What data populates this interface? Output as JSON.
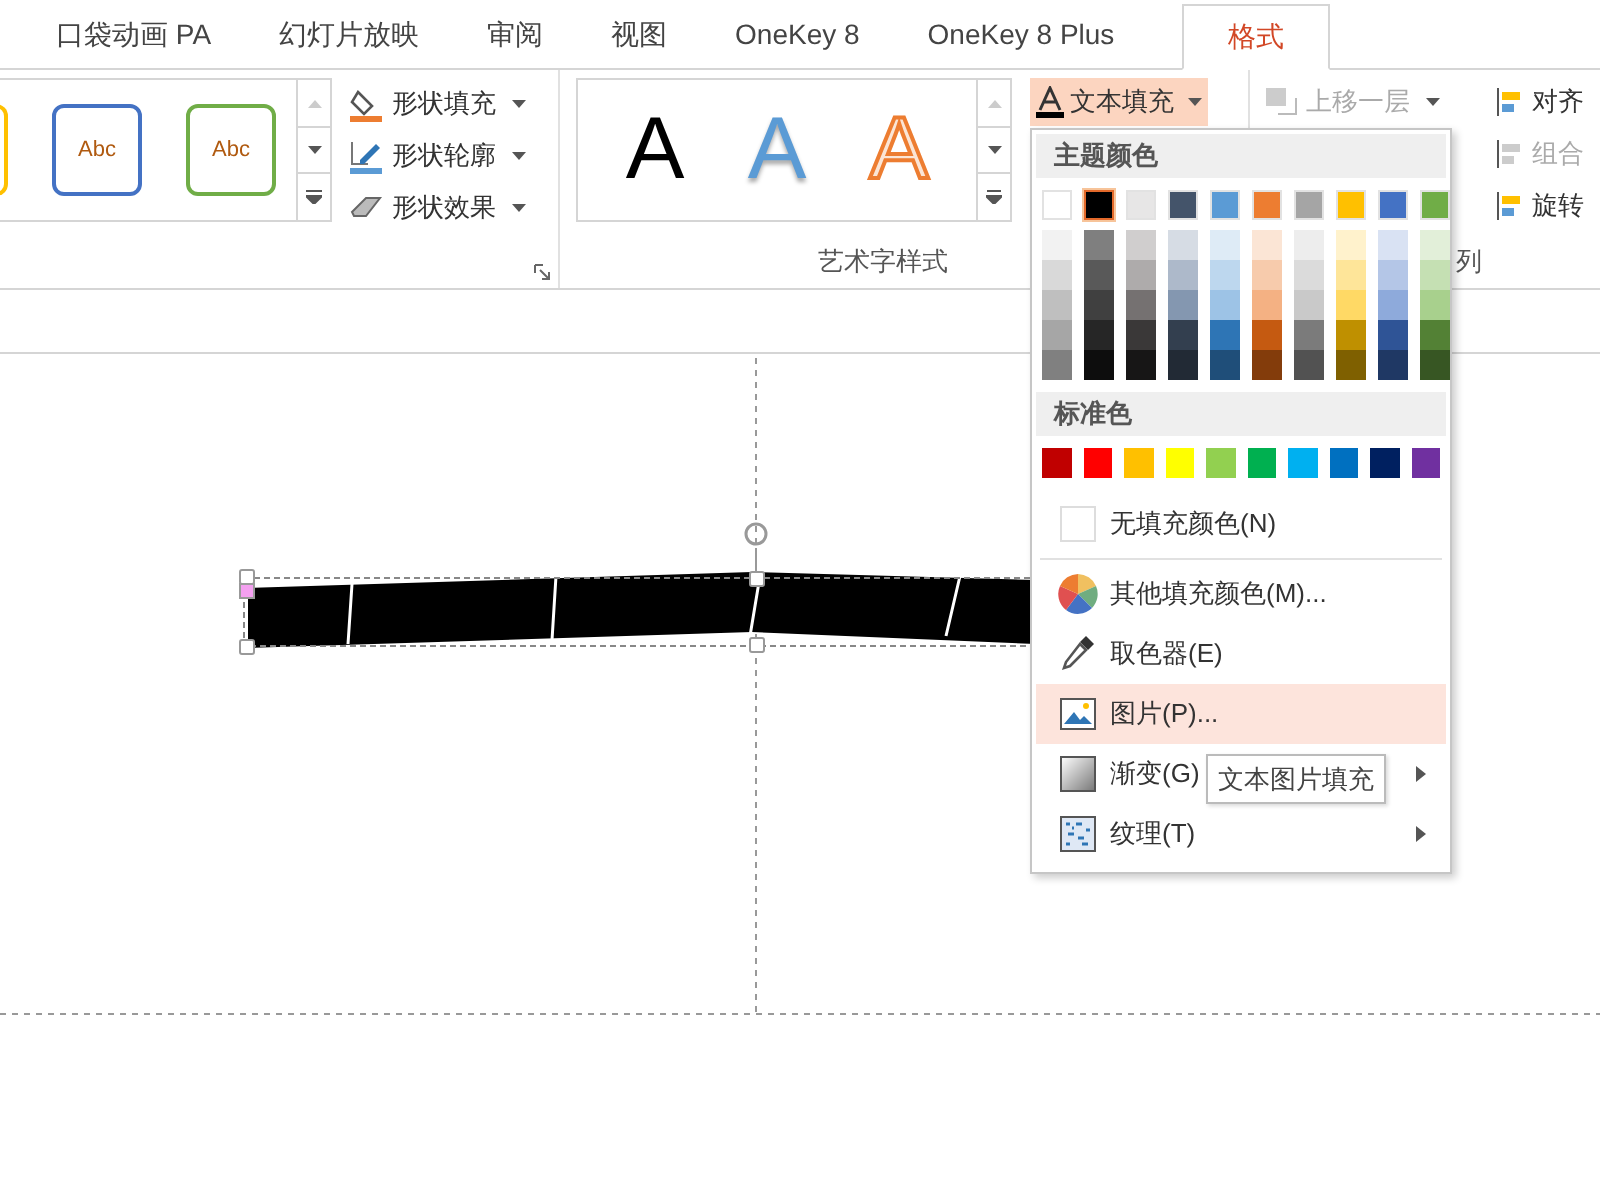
{
  "tabs": [
    {
      "label": "口袋动画 PA",
      "selected": false
    },
    {
      "label": "幻灯片放映",
      "selected": false
    },
    {
      "label": "审阅",
      "selected": false
    },
    {
      "label": "视图",
      "selected": false
    },
    {
      "label": "OneKey 8",
      "selected": false
    },
    {
      "label": "OneKey 8 Plus",
      "selected": false
    },
    {
      "label": "格式",
      "selected": true
    }
  ],
  "shape_styles": {
    "thumbnails": [
      {
        "color": "#ffc000"
      },
      {
        "label": "Abc",
        "color": "#4472c4"
      },
      {
        "label": "Abc",
        "color": "#70ad47"
      }
    ],
    "commands": [
      {
        "label": "形状填充",
        "kind": "fill"
      },
      {
        "label": "形状轮廓",
        "kind": "outline"
      },
      {
        "label": "形状效果",
        "kind": "effect"
      }
    ]
  },
  "wordart": {
    "label": "艺术字样式",
    "samples": [
      {
        "text": "A",
        "kind": "plain"
      },
      {
        "text": "A",
        "kind": "blue"
      },
      {
        "text": "A",
        "kind": "outline"
      }
    ],
    "text_fill": {
      "label": "文本填充",
      "expanded": true
    }
  },
  "arrange": {
    "commands": [
      {
        "label": "上移一层",
        "disabled": true
      },
      {
        "label": "对齐",
        "disabled": false
      },
      {
        "label": "组合",
        "disabled": true
      },
      {
        "label": "旋转",
        "disabled": false
      }
    ],
    "label": "列"
  },
  "menu": {
    "theme_header": "主题颜色",
    "theme_colors": [
      {
        "color": "#ffffff",
        "selected": false,
        "shades": [
          {
            "color": "#f2f2f2"
          },
          {
            "color": "#d9d9d9"
          },
          {
            "color": "#bfbfbf"
          },
          {
            "color": "#a6a6a6"
          },
          {
            "color": "#808080"
          }
        ]
      },
      {
        "color": "#000000",
        "selected": true,
        "shades": [
          {
            "color": "#7f7f7f"
          },
          {
            "color": "#595959"
          },
          {
            "color": "#404040"
          },
          {
            "color": "#262626"
          },
          {
            "color": "#0d0d0d"
          }
        ]
      },
      {
        "color": "#e7e6e6",
        "selected": false,
        "shades": [
          {
            "color": "#d0cece"
          },
          {
            "color": "#aeabab"
          },
          {
            "color": "#757171"
          },
          {
            "color": "#3a3838"
          },
          {
            "color": "#171616"
          }
        ]
      },
      {
        "color": "#44546a",
        "selected": false,
        "shades": [
          {
            "color": "#d6dce4"
          },
          {
            "color": "#adb9ca"
          },
          {
            "color": "#8497b0"
          },
          {
            "color": "#333f4f"
          },
          {
            "color": "#222a35"
          }
        ]
      },
      {
        "color": "#5b9bd5",
        "selected": false,
        "shades": [
          {
            "color": "#deebf6"
          },
          {
            "color": "#bdd7ee"
          },
          {
            "color": "#9dc3e6"
          },
          {
            "color": "#2e75b5"
          },
          {
            "color": "#1f4e79"
          }
        ]
      },
      {
        "color": "#ed7d31",
        "selected": false,
        "shades": [
          {
            "color": "#fbe5d5"
          },
          {
            "color": "#f7cbac"
          },
          {
            "color": "#f4b183"
          },
          {
            "color": "#c55a11"
          },
          {
            "color": "#833c0b"
          }
        ]
      },
      {
        "color": "#a5a5a5",
        "selected": false,
        "shades": [
          {
            "color": "#ededed"
          },
          {
            "color": "#dbdbdb"
          },
          {
            "color": "#c9c9c9"
          },
          {
            "color": "#7b7b7b"
          },
          {
            "color": "#525252"
          }
        ]
      },
      {
        "color": "#ffc000",
        "selected": false,
        "shades": [
          {
            "color": "#fff2cc"
          },
          {
            "color": "#fee599"
          },
          {
            "color": "#ffd965"
          },
          {
            "color": "#bf9000"
          },
          {
            "color": "#7f6000"
          }
        ]
      },
      {
        "color": "#4472c4",
        "selected": false,
        "shades": [
          {
            "color": "#d9e2f3"
          },
          {
            "color": "#b4c6e7"
          },
          {
            "color": "#8eaadb"
          },
          {
            "color": "#2f5496"
          },
          {
            "color": "#1f3864"
          }
        ]
      },
      {
        "color": "#70ad47",
        "selected": false,
        "shades": [
          {
            "color": "#e2efd9"
          },
          {
            "color": "#c5e0b3"
          },
          {
            "color": "#a8d08d"
          },
          {
            "color": "#538135"
          },
          {
            "color": "#375623"
          }
        ]
      }
    ],
    "standard_header": "标准色",
    "standard_colors": [
      {
        "color": "#c00000",
        "selected": false
      },
      {
        "color": "#ff0000",
        "selected": false
      },
      {
        "color": "#ffc000",
        "selected": false
      },
      {
        "color": "#ffff00",
        "selected": false
      },
      {
        "color": "#92d050",
        "selected": false
      },
      {
        "color": "#00b050",
        "selected": false
      },
      {
        "color": "#00b0f0",
        "selected": false
      },
      {
        "color": "#0070c0",
        "selected": false
      },
      {
        "color": "#002060",
        "selected": false
      },
      {
        "color": "#7030a0",
        "selected": false
      }
    ],
    "items": [
      {
        "label": "无填充颜色(N)",
        "kind": "none",
        "selected": false,
        "submenu": false
      },
      {
        "label": "其他填充颜色(M)...",
        "kind": "more",
        "selected": false,
        "submenu": false
      },
      {
        "label": "取色器(E)",
        "kind": "eyedropper",
        "selected": false,
        "submenu": false
      },
      {
        "label": "图片(P)...",
        "kind": "picture",
        "selected": true,
        "submenu": false
      },
      {
        "label": "渐变(G)",
        "kind": "gradient",
        "selected": false,
        "submenu": true
      },
      {
        "label": "纹理(T)",
        "kind": "texture",
        "selected": false,
        "submenu": true
      }
    ]
  },
  "tooltip": "文本图片填充"
}
